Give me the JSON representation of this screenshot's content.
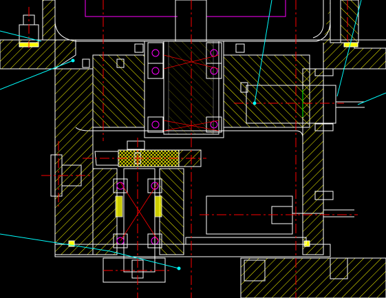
{
  "drawing": {
    "description_visible_text": "",
    "background": "#000000",
    "colors": {
      "outline": "#ffffff",
      "hatch": "#ffff00",
      "center_line": "#ff0000",
      "leader": "#00ffff",
      "accent_magenta": "#ff00ff",
      "accent_green": "#00ff00",
      "fill_yellow": "#ffff00"
    },
    "icons": [
      "bolt-icon",
      "bearing-icon",
      "gear-icon",
      "cylinder-icon",
      "spring-icon"
    ]
  }
}
